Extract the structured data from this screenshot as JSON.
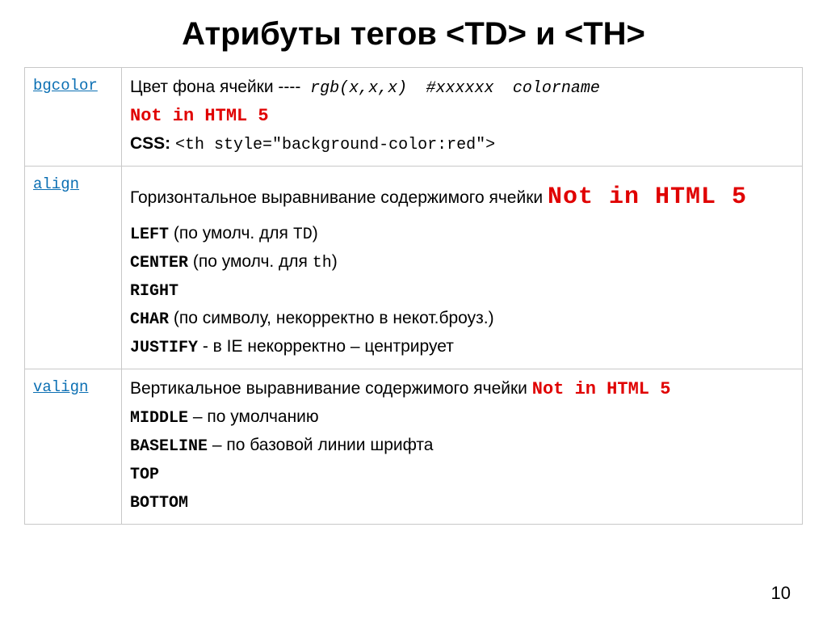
{
  "title": "Атрибуты тегов <TD> и <TH>",
  "rows": {
    "bgcolor": {
      "attr": "bgcolor",
      "desc_prefix": "Цвет фона ячейки ----",
      "rgb": "rgb(x,x,x)",
      "hex": "#xxxxxx",
      "colorname": "colorname",
      "notin": "Not in HTML 5",
      "css_label": "CSS:",
      "css_code": "<th style=\"background-color:red\">"
    },
    "align": {
      "attr": "align",
      "desc": "Горизонтальное выравнивание содержимого ячейки",
      "notin": "Not in HTML 5",
      "left_code": "LEFT",
      "left_note": " (по умолч. для ",
      "left_tag": "TD",
      "close_paren": ")",
      "center_code": "CENTER",
      "center_note": " (по умолч. для ",
      "center_tag": "th",
      "right_code": "RIGHT",
      "char_code": "CHAR",
      "char_note": " (по символу, некорректно в некот.броуз.)",
      "justify_code": "JUSTIFY",
      "justify_note": " - в IE некорректно – центрирует"
    },
    "valign": {
      "attr": "valign",
      "desc": "Вертикальное выравнивание содержимого ячейки",
      "notin": "Not in HTML 5",
      "middle_code": "MIDDLE",
      "middle_note": " – по умолчанию",
      "baseline_code": "BASELINE",
      "baseline_note": " – по базовой линии шрифта",
      "top_code": "TOP",
      "bottom_code": "BOTTOM"
    }
  },
  "page_number": "10"
}
